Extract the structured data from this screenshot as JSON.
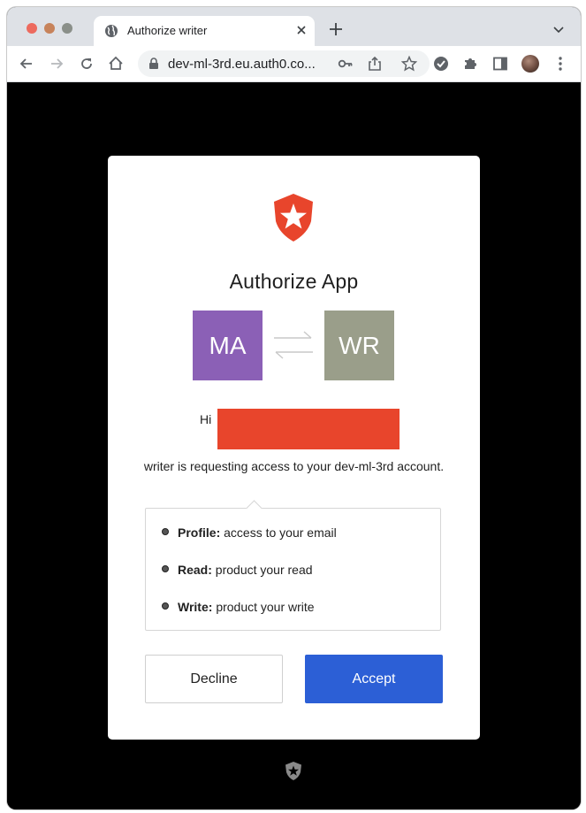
{
  "browser": {
    "tab_title": "Authorize writer",
    "url": "dev-ml-3rd.eu.auth0.co...",
    "icons": [
      "globe-icon",
      "close-icon",
      "plus-icon",
      "chevron-down-icon",
      "back-arrow-icon",
      "forward-arrow-icon",
      "reload-icon",
      "home-icon",
      "lock-icon",
      "key-icon",
      "share-icon",
      "star-icon",
      "check-circle-icon",
      "extensions-icon",
      "side-panel-icon",
      "profile-avatar",
      "more-vert-icon"
    ]
  },
  "consent": {
    "title": "Authorize App",
    "apps": {
      "left": {
        "initials": "MA",
        "color": "#8b60b6"
      },
      "right": {
        "initials": "WR",
        "color": "#9a9e8a"
      }
    },
    "greeting": "Hi",
    "request_text": "writer is requesting access to your dev-ml-3rd account.",
    "scopes": [
      {
        "name": "Profile:",
        "description": "access to your email"
      },
      {
        "name": "Read:",
        "description": "product your read"
      },
      {
        "name": "Write:",
        "description": "product your write"
      }
    ],
    "decline_label": "Decline",
    "accept_label": "Accept",
    "accent_color": "#2c5fd6",
    "brand_color": "#e8452c"
  }
}
